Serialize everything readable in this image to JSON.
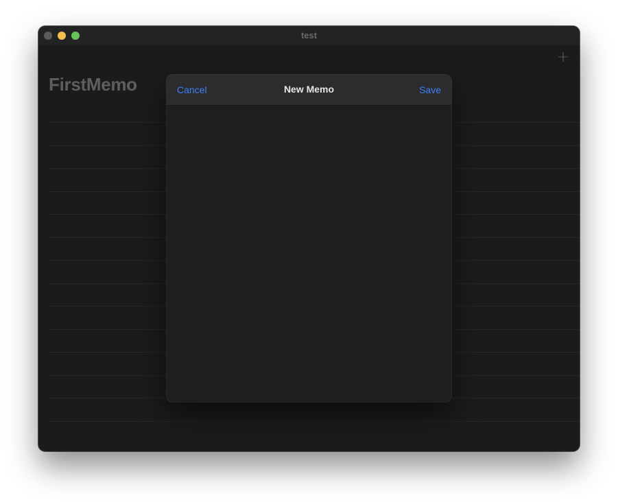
{
  "window": {
    "title": "test"
  },
  "main": {
    "title": "FirstMemo",
    "add_icon": "plus-icon",
    "rows": 14
  },
  "modal": {
    "cancel_label": "Cancel",
    "title": "New Memo",
    "save_label": "Save",
    "editor_value": ""
  },
  "colors": {
    "accent": "#3b82f6",
    "window_bg": "#1b1b1b",
    "modal_header_bg": "#2c2c2e",
    "close_button": "#5a5a5a",
    "minimize_button": "#f5bf4f",
    "zoom_button": "#61c454"
  }
}
